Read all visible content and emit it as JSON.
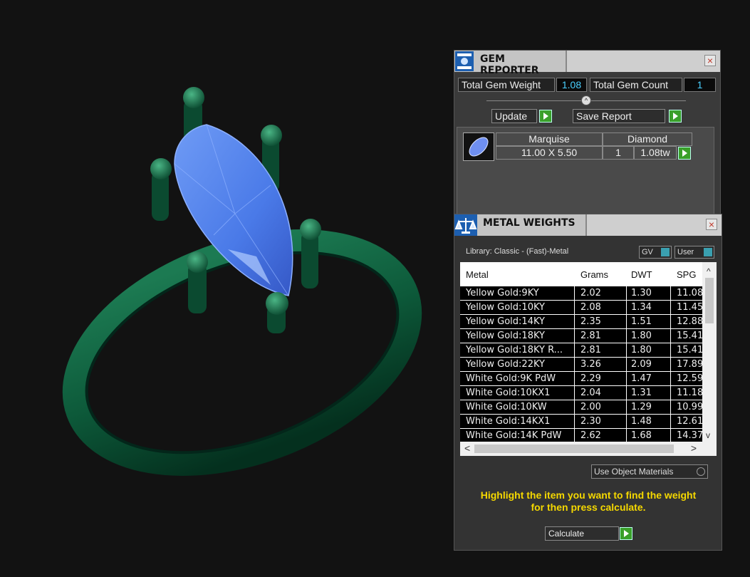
{
  "gem_reporter": {
    "title": "GEM REPORTER",
    "close": "×",
    "total_gem_weight_label": "Total Gem Weight",
    "total_gem_weight_value": "1.08",
    "total_gem_count_label": "Total Gem Count",
    "total_gem_count_value": "1",
    "update_label": "Update",
    "save_report_label": "Save Report",
    "gem": {
      "shape": "Marquise",
      "type": "Diamond",
      "size": "11.00 X 5.50",
      "qty": "1",
      "weight": "1.08tw"
    }
  },
  "metal_weights": {
    "title": "METAL WEIGHTS",
    "close": "×",
    "library": "Library: Classic - (Fast)-Metal",
    "gv_label": "GV",
    "user_label": "User",
    "columns": [
      "Metal",
      "Grams",
      "DWT",
      "SPG"
    ],
    "rows": [
      {
        "metal": "Yellow Gold:9KY",
        "grams": "2.02",
        "dwt": "1.30",
        "spg": "11.08"
      },
      {
        "metal": "Yellow Gold:10KY",
        "grams": "2.08",
        "dwt": "1.34",
        "spg": "11.45"
      },
      {
        "metal": "Yellow Gold:14KY",
        "grams": "2.35",
        "dwt": "1.51",
        "spg": "12.88"
      },
      {
        "metal": "Yellow Gold:18KY",
        "grams": "2.81",
        "dwt": "1.80",
        "spg": "15.41"
      },
      {
        "metal": "Yellow Gold:18KY R...",
        "grams": "2.81",
        "dwt": "1.80",
        "spg": "15.41"
      },
      {
        "metal": "Yellow Gold:22KY",
        "grams": "3.26",
        "dwt": "2.09",
        "spg": "17.89"
      },
      {
        "metal": "White Gold:9K PdW",
        "grams": "2.29",
        "dwt": "1.47",
        "spg": "12.59"
      },
      {
        "metal": "White Gold:10KX1",
        "grams": "2.04",
        "dwt": "1.31",
        "spg": "11.18"
      },
      {
        "metal": "White Gold:10KW",
        "grams": "2.00",
        "dwt": "1.29",
        "spg": "10.99"
      },
      {
        "metal": "White Gold:14KX1",
        "grams": "2.30",
        "dwt": "1.48",
        "spg": "12.61"
      },
      {
        "metal": "White Gold:14K PdW",
        "grams": "2.62",
        "dwt": "1.68",
        "spg": "14.37"
      }
    ],
    "use_object_materials": "Use Object Materials",
    "hint_line1": "Highlight the item you want to find the weight",
    "hint_line2": "for then press calculate.",
    "calculate_label": "Calculate"
  },
  "colors": {
    "ring": "#0f5a3c",
    "gem": "#4a7ae8",
    "accent_yellow": "#f5d800",
    "value_cyan": "#4ad0ff",
    "go_green": "#3aa02a"
  }
}
